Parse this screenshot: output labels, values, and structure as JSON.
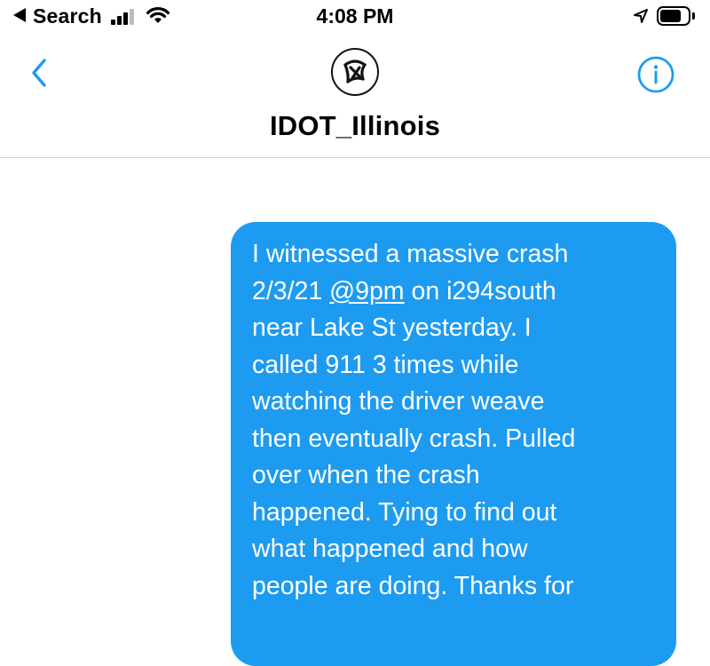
{
  "status_bar": {
    "back_label": "Search",
    "time": "4:08 PM",
    "signal_bars_active": 3,
    "signal_bars_total": 4,
    "battery_level": 0.75,
    "icons": [
      "back-triangle-icon",
      "signal-icon",
      "wifi-icon",
      "location-arrow-icon",
      "battery-icon"
    ]
  },
  "header": {
    "contact_name": "IDOT_Illinois",
    "back_icon": "chevron-left-icon",
    "info_icon": "info-circle-icon",
    "avatar_icon": "idot-logo",
    "accent_color": "#1d9bf0"
  },
  "message": {
    "bubble_color": "#1d9bf0",
    "text_color": "#ffffff",
    "lines": [
      "I witnessed a massive crash",
      "2/3/21",
      "@9pm",
      "on i294south",
      "near Lake St yesterday. I",
      "called 911 3 times while",
      "watching the driver weave",
      "then eventually crash. Pulled",
      "over when the crash",
      "happened. Tying to find out",
      "what happened and how",
      "people are doing. Thanks for"
    ]
  }
}
